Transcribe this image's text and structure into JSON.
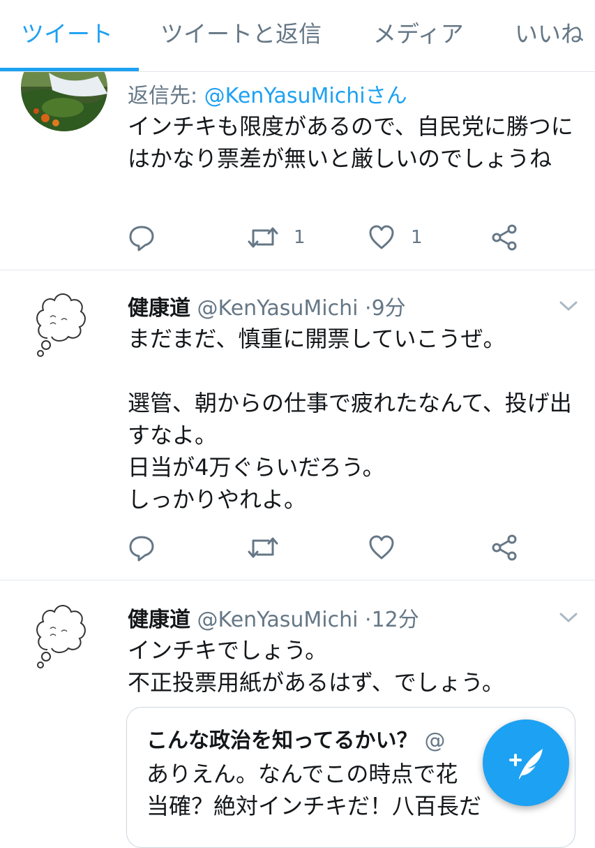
{
  "tabs": [
    {
      "label": "ツイート",
      "active": true
    },
    {
      "label": "ツイートと返信",
      "active": false
    },
    {
      "label": "メディア",
      "active": false
    },
    {
      "label": "いいね",
      "active": false
    }
  ],
  "colors": {
    "accent": "#1da1f2",
    "secondary_text": "#657786",
    "border": "#e1e8ed"
  },
  "tweets": [
    {
      "reply_label": "返信先:",
      "reply_handle": "@KenYasuMichiさん",
      "text": "インチキも限度があるので、自民党に勝つにはかなり票差が無いと厳しいのでしょうね",
      "retweets": "1",
      "likes": "1"
    },
    {
      "name": "健康道",
      "handle": "@KenYasuMichi",
      "separator": "·",
      "time": "9分",
      "text": "まだまだ、慎重に開票していこうぜ。\n\n選管、朝からの仕事で疲れたなんて、投げ出すなよ。\n日当が4万ぐらいだろう。\nしっかりやれよ。"
    },
    {
      "name": "健康道",
      "handle": "@KenYasuMichi",
      "separator": "·",
      "time": "12分",
      "text": "インチキでしょう。\n不正投票用紙があるはず、でしょう。",
      "quote": {
        "author": "こんな政治を知ってるかい？",
        "handle": "@",
        "text": "ありえん。なんでこの時点で花\n当確？絶対インチキだ！八百長だ"
      }
    }
  ],
  "icons": {
    "reply": "reply-icon",
    "retweet": "retweet-icon",
    "like": "heart-icon",
    "share": "share-icon",
    "caret": "chevron-down-icon",
    "compose": "compose-tweet-icon"
  }
}
